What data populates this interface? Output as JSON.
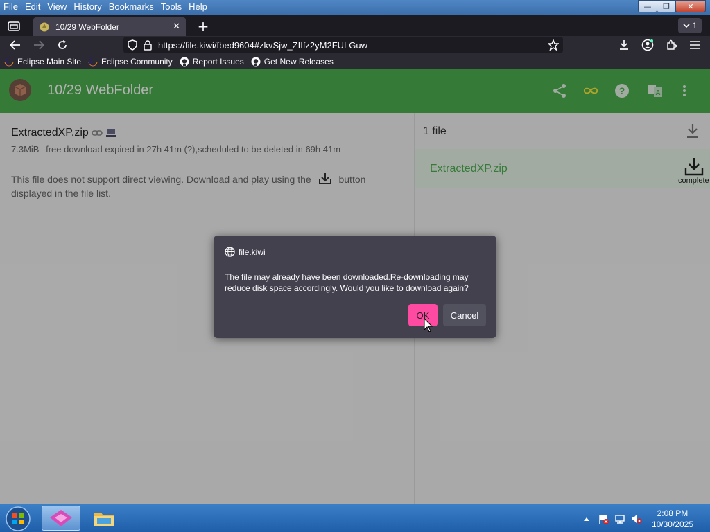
{
  "menubar": {
    "items": [
      "File",
      "Edit",
      "View",
      "History",
      "Bookmarks",
      "Tools",
      "Help"
    ]
  },
  "tab": {
    "title": "10/29 WebFolder",
    "close_glyph": "✕",
    "new_tab_glyph": "+",
    "list_count": "1"
  },
  "navbar": {
    "url": "https://file.kiwi/fbed9604#zkvSjw_ZIIfz2yM2FULGuw"
  },
  "bookmarks": [
    {
      "label": "Eclipse Main Site",
      "icon": "eclipse-icon"
    },
    {
      "label": "Eclipse Community",
      "icon": "eclipse-icon"
    },
    {
      "label": "Report Issues",
      "icon": "github-icon"
    },
    {
      "label": "Get New Releases",
      "icon": "github-icon"
    }
  ],
  "app": {
    "title": "10/29 WebFolder",
    "brand_color": "#4caf50",
    "header_icons": [
      "share-icon",
      "infinity-icon",
      "help-icon",
      "translate-icon",
      "more-vert-icon"
    ]
  },
  "file_detail": {
    "name": "ExtractedXP.zip",
    "size": "7.3MiB",
    "status": "free download expired in 27h 41m (?),scheduled to be deleted in 69h 41m",
    "notice_before": "This file does not support direct viewing. Download and play using the",
    "notice_after": "button displayed in the file list."
  },
  "file_list": {
    "count_label": "1 file",
    "items": [
      {
        "name": "ExtractedXP.zip",
        "status": "complete"
      }
    ]
  },
  "dialog": {
    "origin": "file.kiwi",
    "message": "The file may already have been downloaded.Re-downloading may reduce disk space accordingly. Would you like to download again?",
    "ok_label": "OK",
    "cancel_label": "Cancel",
    "ok_color": "#ff4aa2"
  },
  "taskbar": {
    "time": "2:08 PM",
    "date": "10/30/2025"
  }
}
